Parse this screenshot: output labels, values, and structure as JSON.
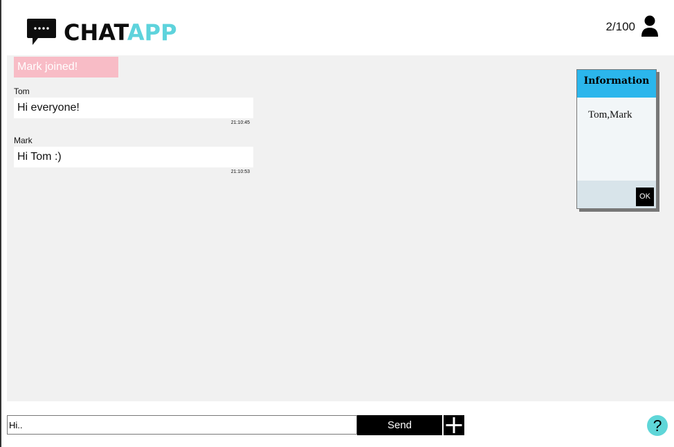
{
  "header": {
    "logo": {
      "text_chat": "CHAT",
      "text_app": "APP"
    },
    "user_count": "2/100"
  },
  "chat": {
    "join_notice": "Mark joined!",
    "messages": [
      {
        "author": "Tom",
        "text": "Hi everyone!",
        "time": "21:10:45"
      },
      {
        "author": "Mark",
        "text": "Hi Tom :)",
        "time": "21:10:53"
      }
    ]
  },
  "info_panel": {
    "title": "Information",
    "content": "Tom,Mark",
    "ok_label": "OK"
  },
  "composer": {
    "input_value": "Hi..",
    "send_label": "Send"
  },
  "help": {
    "label": "?"
  },
  "colors": {
    "accent_cyan": "#5ed3dc",
    "info_header_blue": "#2bb6ec",
    "join_pink": "#f8bcc6",
    "chat_bg": "#f1f1f1"
  },
  "icons": [
    "chat-bubble-icon",
    "user-icon",
    "plus-icon",
    "help-icon"
  ]
}
